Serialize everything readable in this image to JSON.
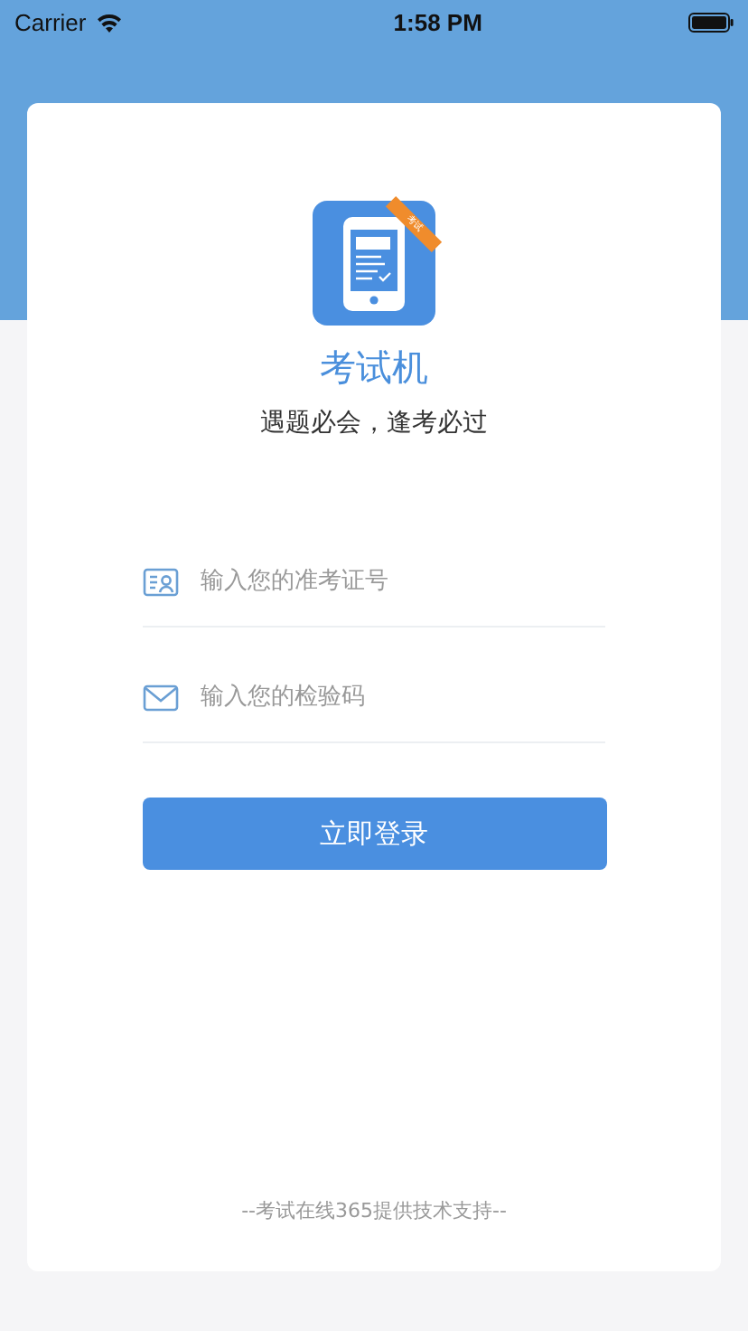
{
  "status_bar": {
    "carrier": "Carrier",
    "time": "1:58 PM"
  },
  "app": {
    "badge": "考试",
    "name": "考试机",
    "slogan": "遇题必会，逢考必过"
  },
  "fields": [
    {
      "kind": "id",
      "placeholder": "输入您的准考证号"
    },
    {
      "kind": "mail",
      "placeholder": "输入您的检验码"
    }
  ],
  "login_button": "立即登录",
  "footer": "--考试在线365提供技术支持--"
}
